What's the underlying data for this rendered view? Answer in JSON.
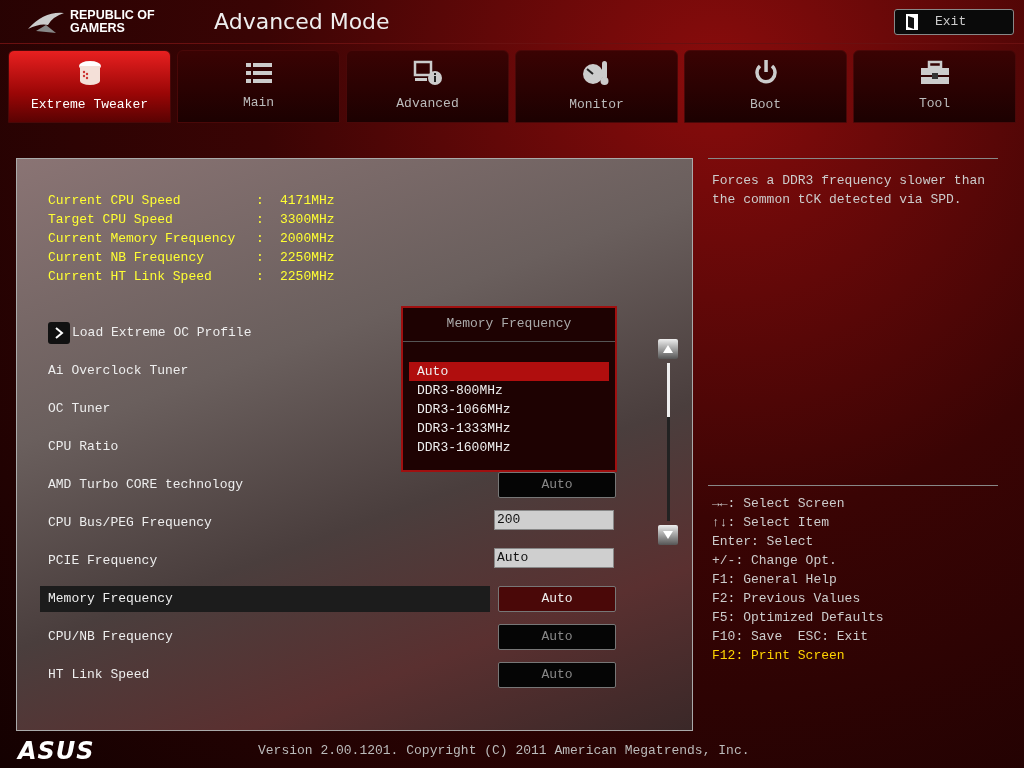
{
  "header": {
    "logo_text": "REPUBLIC OF GAMERS",
    "title": "Advanced Mode",
    "exit_button": "Exit"
  },
  "tabs": [
    {
      "label": "Extreme Tweaker",
      "selected": true
    },
    {
      "label": "Main",
      "selected": false
    },
    {
      "label": "Advanced",
      "selected": false
    },
    {
      "label": "Monitor",
      "selected": false
    },
    {
      "label": "Boot",
      "selected": false
    },
    {
      "label": "Tool",
      "selected": false
    }
  ],
  "info": [
    {
      "label": "Current CPU Speed",
      "value": "4171MHz"
    },
    {
      "label": "Target CPU Speed",
      "value": "3300MHz"
    },
    {
      "label": "Current Memory Frequency",
      "value": "2000MHz"
    },
    {
      "label": "Current NB Frequency",
      "value": "2250MHz"
    },
    {
      "label": "Current HT Link Speed",
      "value": "2250MHz"
    }
  ],
  "info_separator": ":",
  "settings": [
    {
      "kind": "submenu",
      "label": "Load Extreme OC Profile",
      "selected": false
    },
    {
      "kind": "hidden",
      "label": "Ai Overclock Tuner",
      "selected": false
    },
    {
      "kind": "hidden",
      "label": "OC Tuner",
      "selected": false
    },
    {
      "kind": "hidden",
      "label": "CPU Ratio",
      "selected": false
    },
    {
      "kind": "dropdown",
      "label": "AMD Turbo CORE technology",
      "value": "Auto",
      "selected": false
    },
    {
      "kind": "input",
      "label": "CPU Bus/PEG Frequency",
      "value": "200",
      "selected": false
    },
    {
      "kind": "input",
      "label": "PCIE Frequency",
      "value": "Auto",
      "selected": false
    },
    {
      "kind": "dropdown",
      "label": "Memory Frequency",
      "value": "Auto",
      "selected": true
    },
    {
      "kind": "dropdown",
      "label": "CPU/NB Frequency",
      "value": "Auto",
      "selected": false
    },
    {
      "kind": "dropdown",
      "label": "HT Link Speed",
      "value": "Auto",
      "selected": false
    }
  ],
  "popup": {
    "title": "Memory Frequency",
    "options": [
      {
        "label": "Auto",
        "selected": true
      },
      {
        "label": "DDR3-800MHz",
        "selected": false
      },
      {
        "label": "DDR3-1066MHz",
        "selected": false
      },
      {
        "label": "DDR3-1333MHz",
        "selected": false
      },
      {
        "label": "DDR3-1600MHz",
        "selected": false
      }
    ]
  },
  "help_text": "Forces a DDR3 frequency slower than the common tCK detected via SPD.",
  "hotkeys": [
    {
      "text": "→←: Select Screen",
      "highlighted": false
    },
    {
      "text": "↑↓: Select Item",
      "highlighted": false
    },
    {
      "text": "Enter: Select",
      "highlighted": false
    },
    {
      "text": "+/-: Change Opt.",
      "highlighted": false
    },
    {
      "text": "F1: General Help",
      "highlighted": false
    },
    {
      "text": "F2: Previous Values",
      "highlighted": false
    },
    {
      "text": "F5: Optimized Defaults",
      "highlighted": false
    },
    {
      "text": "F10: Save  ESC: Exit",
      "highlighted": false
    },
    {
      "text": "F12: Print Screen",
      "highlighted": true
    }
  ],
  "footer": {
    "brand": "ASUS",
    "version": "Version 2.00.1201. Copyright (C) 2011 American Megatrends, Inc."
  }
}
